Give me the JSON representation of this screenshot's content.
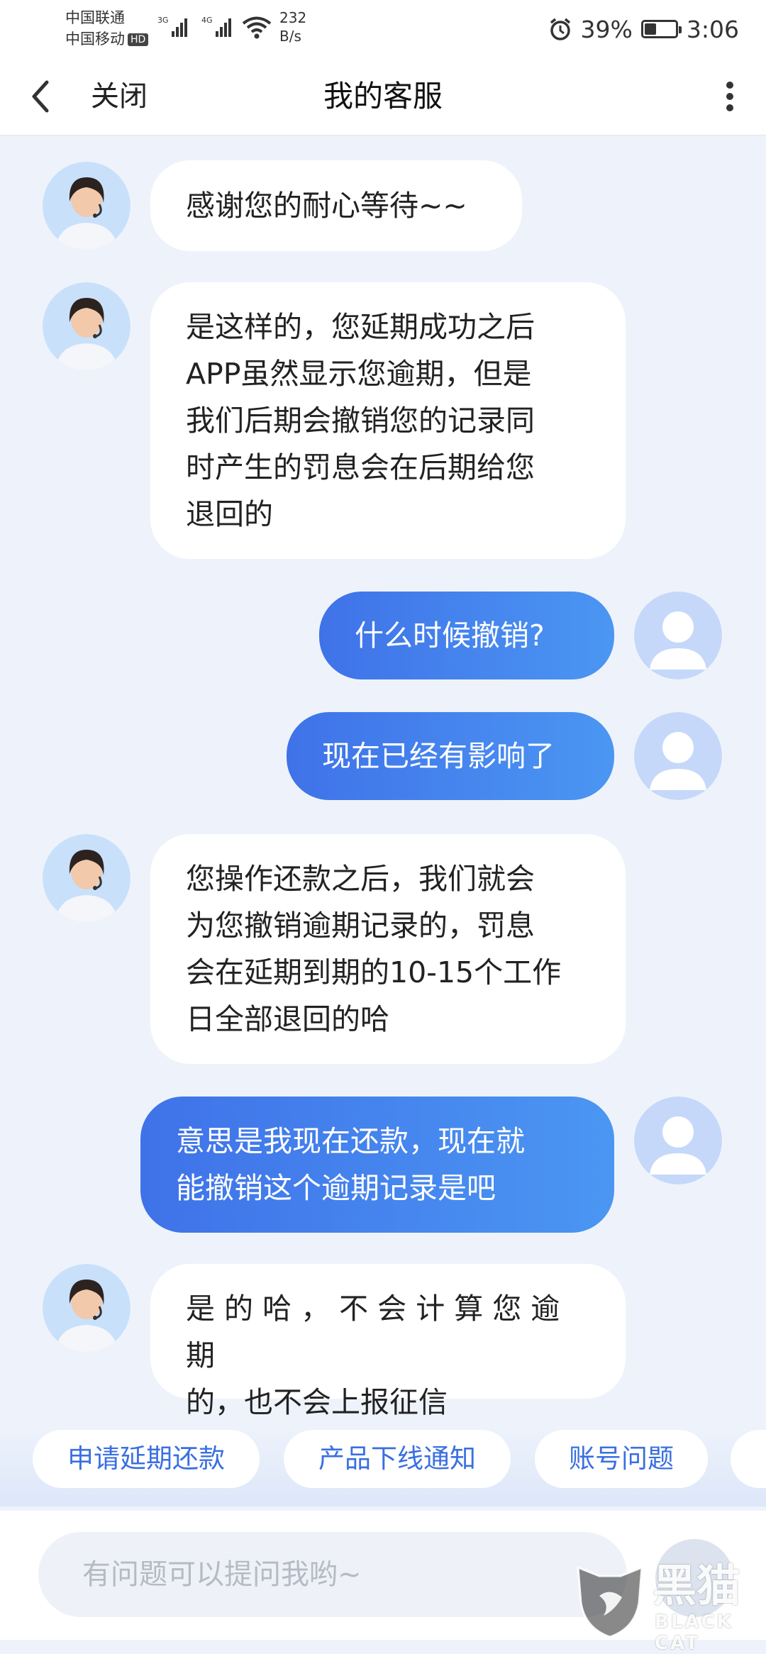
{
  "status_bar": {
    "carrier_1": "中国联通",
    "carrier_2": "中国移动",
    "hd_badge": "HD",
    "net_1": "3G",
    "net_2": "4G",
    "net_speed_value": "232",
    "net_speed_unit": "B/s",
    "battery": "39%",
    "battery_level": 0.39,
    "time": "3:06"
  },
  "header": {
    "close_label": "关闭",
    "title": "我的客服"
  },
  "messages": [
    {
      "from": "agent",
      "text": "感谢您的耐心等待~~"
    },
    {
      "from": "agent",
      "lines": [
        "是这样的，您延期成功之后",
        "APP虽然显示您逾期，但是",
        "我们后期会撤销您的记录同",
        "时产生的罚息会在后期给您",
        "退回的"
      ]
    },
    {
      "from": "user",
      "text": "什么时候撤销?"
    },
    {
      "from": "user",
      "text": "现在已经有影响了"
    },
    {
      "from": "agent",
      "lines": [
        "您操作还款之后，我们就会",
        "为您撤销逾期记录的，罚息",
        "会在延期到期的10-15个工作",
        "日全部退回的哈"
      ]
    },
    {
      "from": "user",
      "lines": [
        "意思是我现在还款，现在就",
        "能撤销这个逾期记录是吧"
      ]
    },
    {
      "from": "agent",
      "lines": [
        "是 的 哈 ， 不 会 计 算 您 逾 期",
        "的，也不会上报征信"
      ]
    }
  ],
  "quick_replies": [
    "申请延期还款",
    "产品下线通知",
    "账号问题"
  ],
  "input": {
    "placeholder": "有问题可以提问我哟~"
  },
  "watermark": {
    "line1": "黑猫",
    "line2": "BLACK CAT"
  },
  "colors": {
    "accent": "#3F72E8",
    "accent_end": "#4B96F3",
    "background": "#EEF3FB",
    "quick_text": "#3A6FE0"
  },
  "icons": {
    "back": "chevron-left-icon",
    "more": "more-vertical-icon",
    "alarm": "alarm-clock-icon",
    "wifi": "wifi-icon",
    "signal": "signal-bars-icon"
  }
}
